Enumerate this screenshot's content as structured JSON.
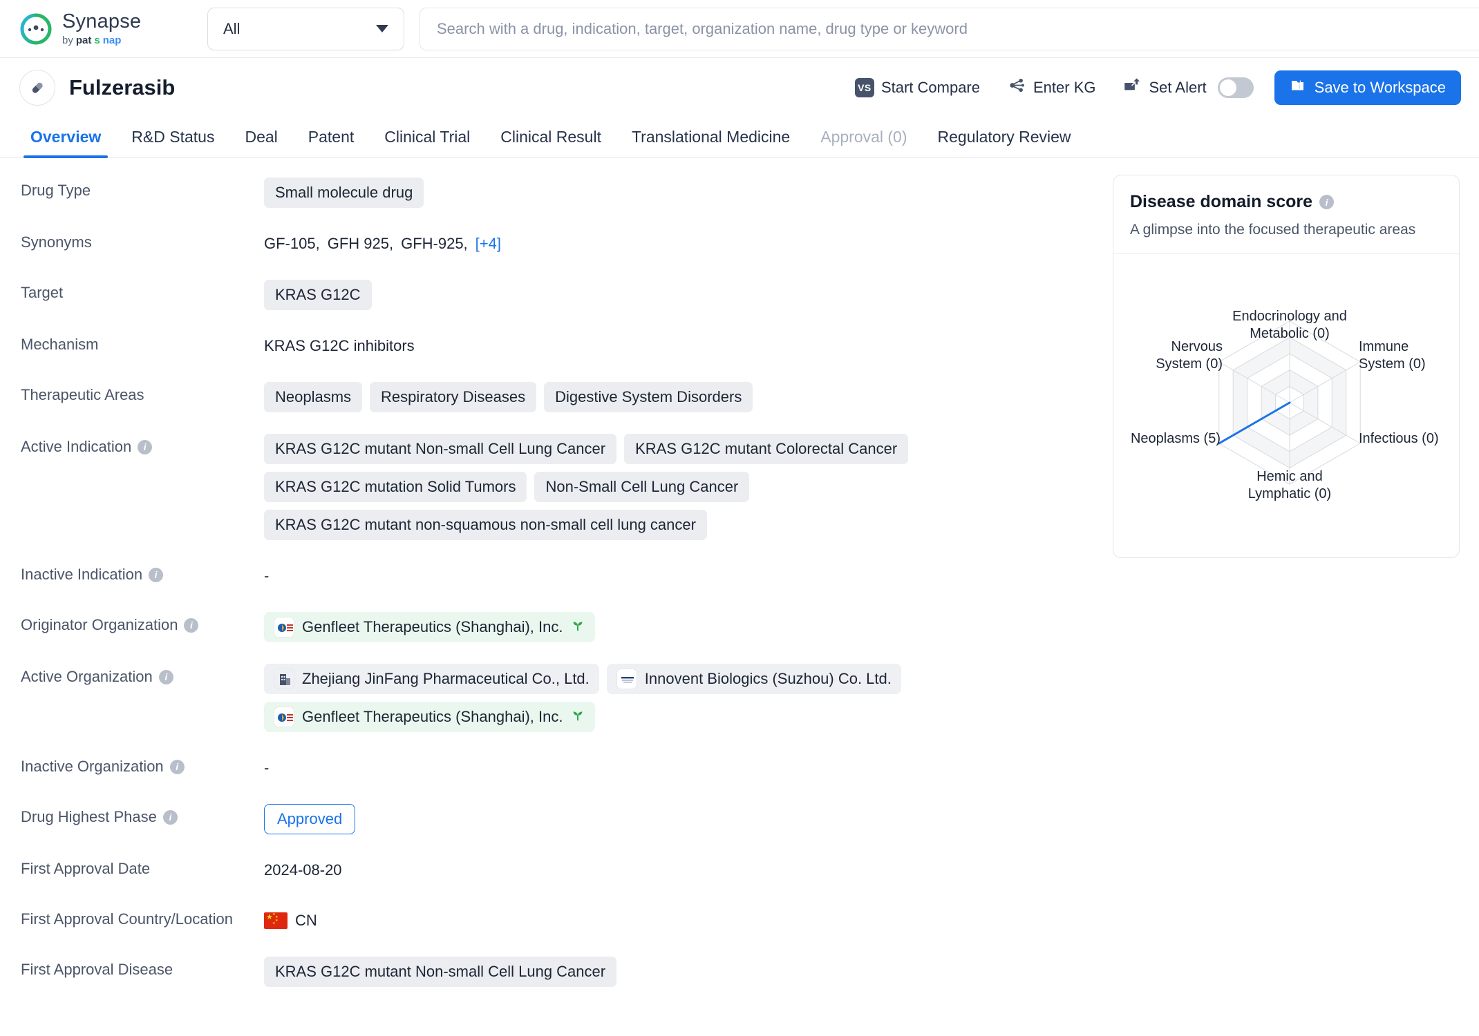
{
  "topbar": {
    "brand_name": "Synapse",
    "brand_by": "by",
    "brand_pat": "pat",
    "brand_s": "s",
    "brand_nap": "nap",
    "scope_value": "All",
    "search_placeholder": "Search with a drug, indication, target, organization name, drug type or keyword",
    "search_value": ""
  },
  "drug_header": {
    "title": "Fulzerasib",
    "start_compare": "Start Compare",
    "vs_icon_text": "VS",
    "enter_kg": "Enter KG",
    "set_alert": "Set Alert",
    "alert_toggle_state": "off",
    "save_to_workspace": "Save to Workspace",
    "accent_color": "#1a73e8"
  },
  "tabs": [
    {
      "label": "Overview",
      "state": "active"
    },
    {
      "label": "R&D Status",
      "state": "normal"
    },
    {
      "label": "Deal",
      "state": "normal"
    },
    {
      "label": "Patent",
      "state": "normal"
    },
    {
      "label": "Clinical Trial",
      "state": "normal"
    },
    {
      "label": "Clinical Result",
      "state": "normal"
    },
    {
      "label": "Translational Medicine",
      "state": "normal"
    },
    {
      "label": "Approval (0)",
      "state": "disabled"
    },
    {
      "label": "Regulatory Review",
      "state": "normal"
    }
  ],
  "fields": {
    "drug_type_label": "Drug Type",
    "drug_type_value": "Small molecule drug",
    "synonyms_label": "Synonyms",
    "synonyms_values": [
      "GF-105,",
      "GFH 925,",
      "GFH-925,"
    ],
    "synonyms_more": "[+4]",
    "target_label": "Target",
    "target_value": "KRAS G12C",
    "mechanism_label": "Mechanism",
    "mechanism_value": "KRAS G12C inhibitors",
    "therapeutic_areas_label": "Therapeutic Areas",
    "therapeutic_areas": [
      "Neoplasms",
      "Respiratory Diseases",
      "Digestive System Disorders"
    ],
    "active_indication_label": "Active Indication",
    "active_indications": [
      "KRAS G12C mutant Non-small Cell Lung Cancer",
      "KRAS G12C mutant Colorectal Cancer",
      "KRAS G12C mutation Solid Tumors",
      "Non-Small Cell Lung Cancer",
      "KRAS G12C mutant non-squamous non-small cell lung cancer"
    ],
    "inactive_indication_label": "Inactive Indication",
    "inactive_indication_value": "-",
    "originator_org_label": "Originator Organization",
    "originator_orgs": [
      {
        "name": "Genfleet Therapeutics (Shanghai), Inc.",
        "style": "green",
        "has_sprout": true
      }
    ],
    "active_org_label": "Active Organization",
    "active_orgs": [
      {
        "name": "Zhejiang JinFang Pharmaceutical Co., Ltd.",
        "style": "gray",
        "has_sprout": false
      },
      {
        "name": "Innovent Biologics (Suzhou) Co. Ltd.",
        "style": "gray",
        "has_sprout": false
      },
      {
        "name": "Genfleet Therapeutics (Shanghai), Inc.",
        "style": "green",
        "has_sprout": true
      }
    ],
    "inactive_org_label": "Inactive Organization",
    "inactive_org_value": "-",
    "highest_phase_label": "Drug Highest Phase",
    "highest_phase_value": "Approved",
    "first_approval_date_label": "First Approval Date",
    "first_approval_date_value": "2024-08-20",
    "first_approval_country_label": "First Approval Country/Location",
    "first_approval_country_value": "CN",
    "first_approval_disease_label": "First Approval Disease",
    "first_approval_disease_value": "KRAS G12C mutant Non-small Cell Lung Cancer"
  },
  "side_card": {
    "title": "Disease domain score",
    "subtitle": "A glimpse into the focused therapeutic areas"
  },
  "chart_data": {
    "type": "radar",
    "title": "Disease domain score",
    "subtitle": "A glimpse into the focused therapeutic areas",
    "categories": [
      "Endocrinology and\nMetabolic (0)",
      "Immune\nSystem (0)",
      "Infectious (0)",
      "Hemic and\nLymphatic (0)",
      "Neoplasms (5)",
      "Nervous\nSystem (0)"
    ],
    "axis_names": [
      "Endocrinology and Metabolic",
      "Immune System",
      "Infectious",
      "Hemic and Lymphatic",
      "Neoplasms",
      "Nervous System"
    ],
    "values": [
      0,
      0,
      0,
      0,
      5,
      0
    ],
    "rmax": 5,
    "rings": 5,
    "grid": true,
    "legend": "none",
    "series_color": "#1a73e8",
    "grid_color": "#d7dade"
  }
}
